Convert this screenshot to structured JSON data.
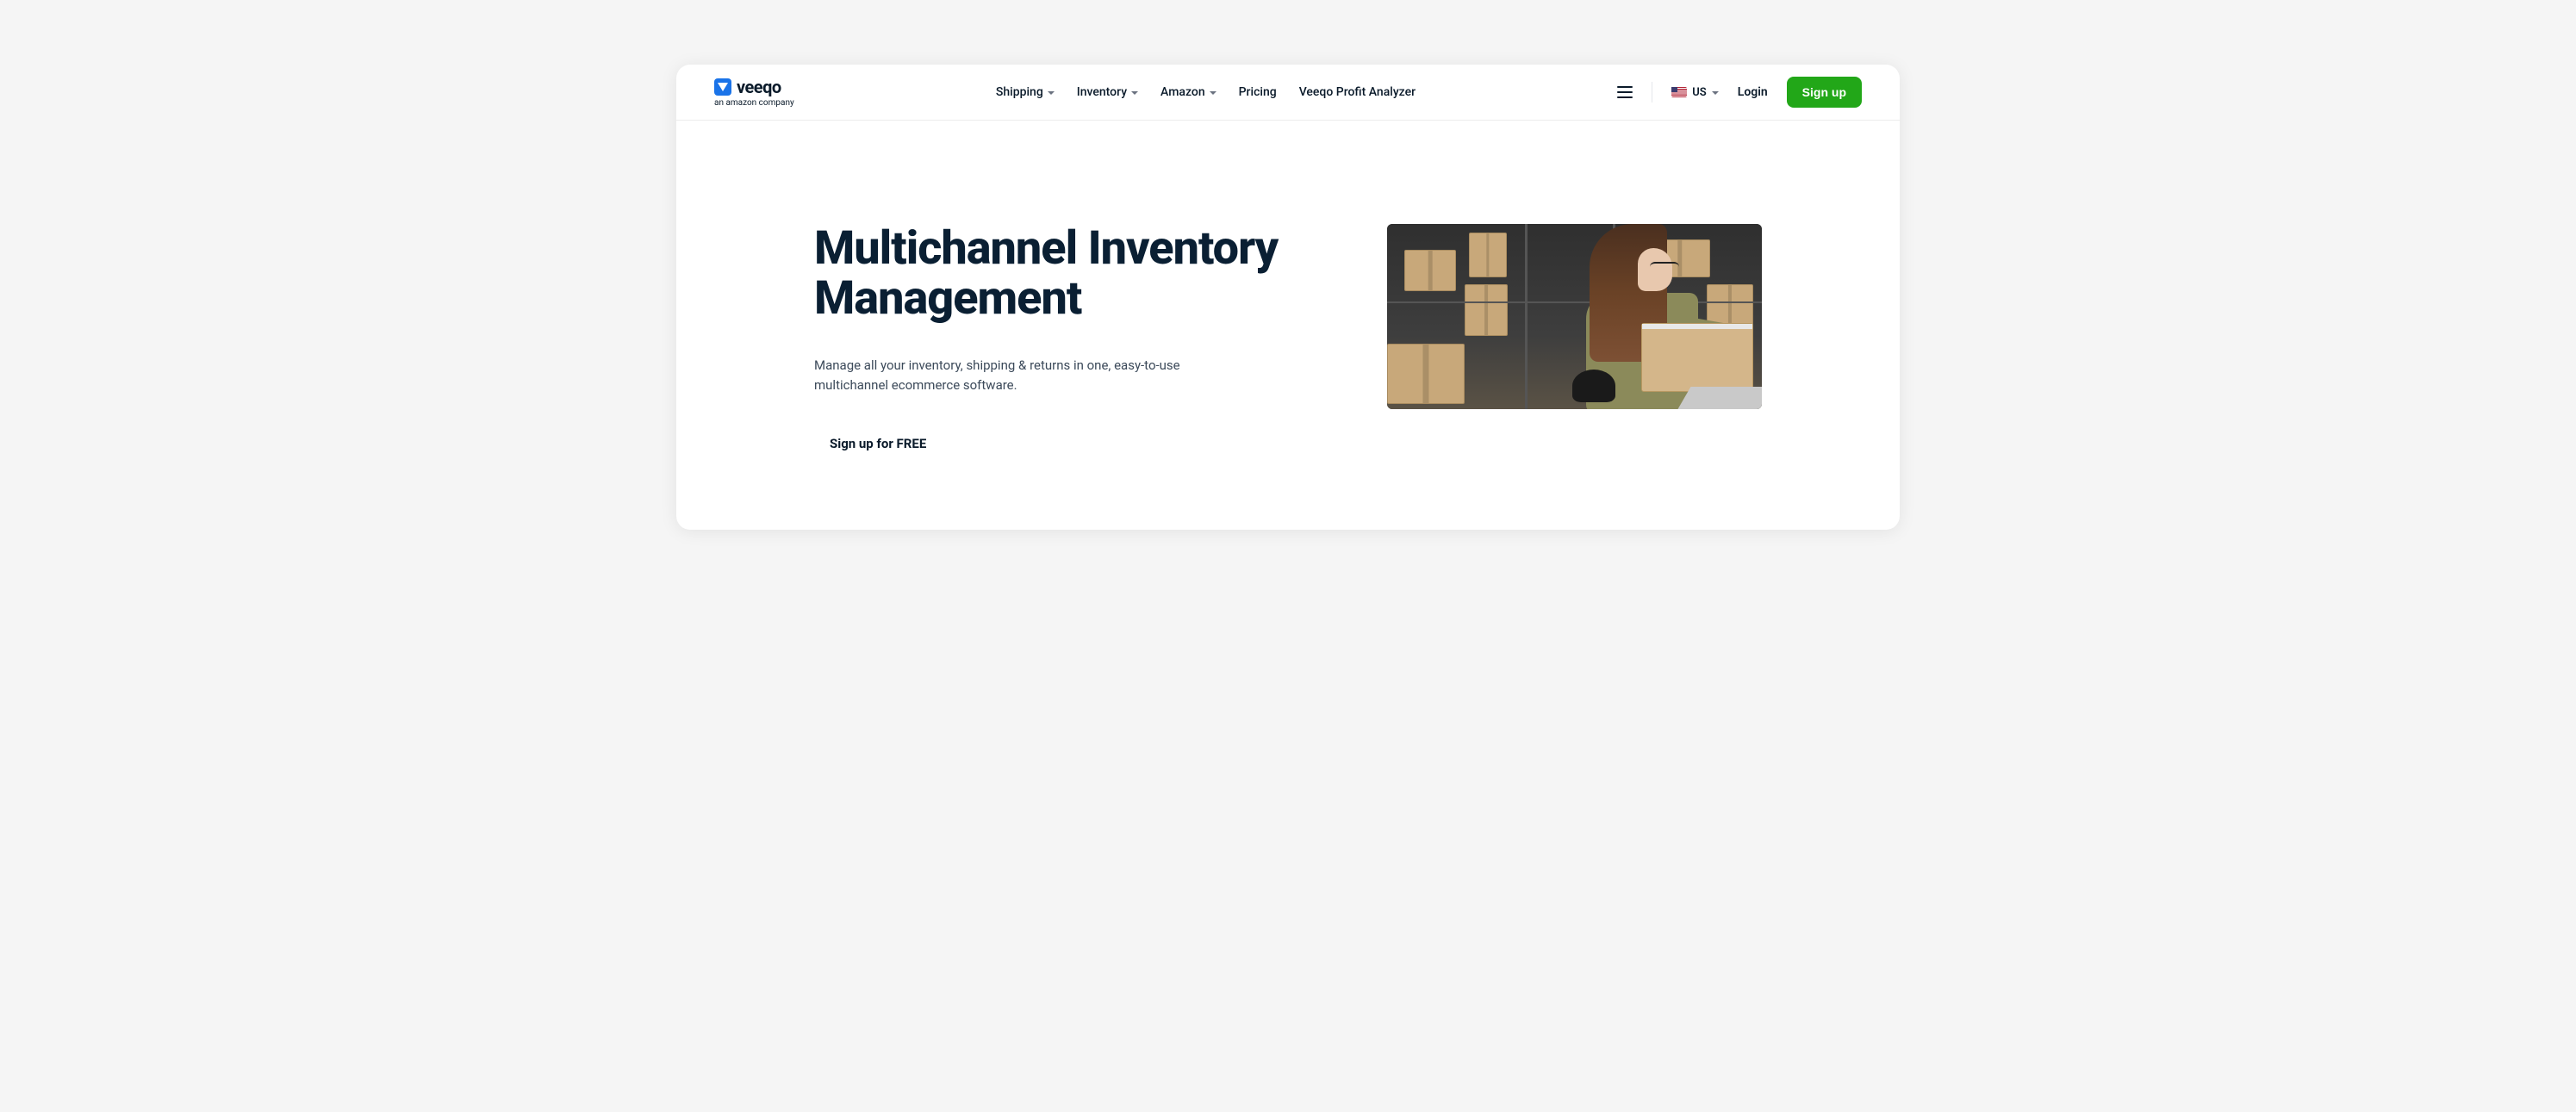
{
  "logo": {
    "brand": "veeqo",
    "tagline": "an amazon company"
  },
  "nav": {
    "shipping": "Shipping",
    "inventory": "Inventory",
    "amazon": "Amazon",
    "pricing": "Pricing",
    "analyzer": "Veeqo Profit Analyzer"
  },
  "header": {
    "locale_code": "US",
    "login": "Login",
    "signup": "Sign up"
  },
  "hero": {
    "title": "Multichannel Inventory Management",
    "subtitle": "Manage all your inventory, shipping & returns in one, easy-to-use multichannel ecommerce software.",
    "cta": "Sign up for FREE"
  }
}
